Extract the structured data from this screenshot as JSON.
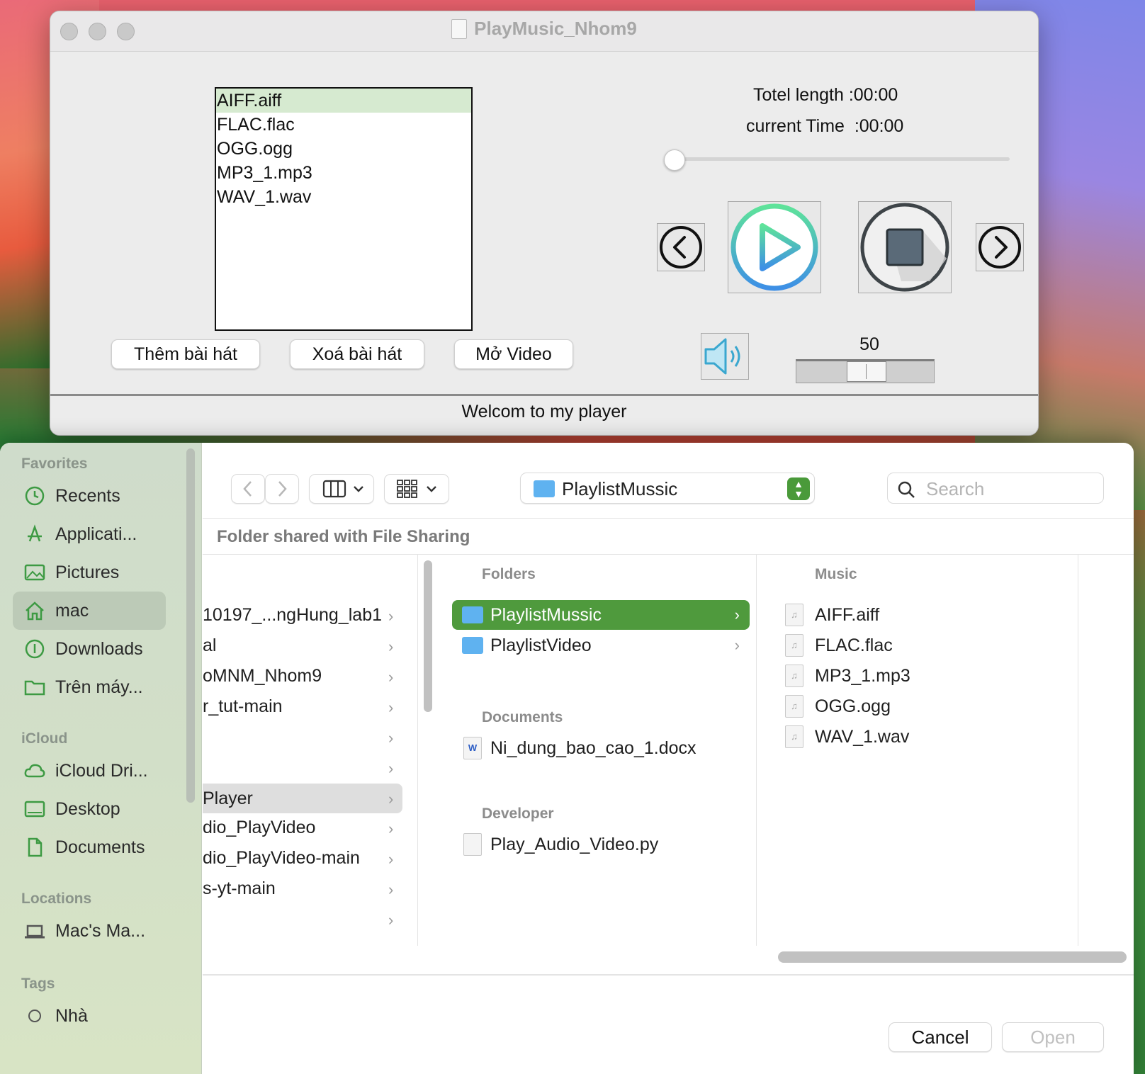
{
  "player": {
    "title": "PlayMusic_Nhom9",
    "playlist": [
      "AIFF.aiff",
      "FLAC.flac",
      "OGG.ogg",
      "MP3_1.mp3",
      "WAV_1.wav"
    ],
    "buttons": {
      "add": "Thêm bài hát",
      "delete": "Xoá bài hát",
      "video": "Mở Video"
    },
    "total_length": "Totel length :00:00",
    "current_time": "current Time  :00:00",
    "progress": 0,
    "volume": "50",
    "status": "Welcom to my player"
  },
  "dialog": {
    "path": "PlaylistMussic",
    "search_placeholder": "Search",
    "shared_banner": "Folder shared with File Sharing",
    "sidebar": {
      "favorites_head": "Favorites",
      "favorites": [
        "Recents",
        "Applicati...",
        "Pictures",
        "mac",
        "Downloads",
        "Trên máy..."
      ],
      "icloud_head": "iCloud",
      "icloud": [
        "iCloud Dri...",
        "Desktop",
        "Documents"
      ],
      "locations_head": "Locations",
      "locations": [
        "Mac's Ma..."
      ],
      "tags_head": "Tags",
      "tags": [
        "Nhà"
      ]
    },
    "col1": [
      "10197_...ngHung_lab1",
      "al",
      "oMNM_Nhom9",
      "r_tut-main",
      "",
      "",
      "Player",
      "dio_PlayVideo",
      "dio_PlayVideo-main",
      "s-yt-main",
      ""
    ],
    "col2": {
      "folders_head": "Folders",
      "folders": [
        "PlaylistMussic",
        "PlaylistVideo"
      ],
      "documents_head": "Documents",
      "documents": [
        "Ni_dung_bao_cao_1.docx"
      ],
      "developer_head": "Developer",
      "developer": [
        "Play_Audio_Video.py"
      ]
    },
    "col3": {
      "music_head": "Music",
      "music": [
        "AIFF.aiff",
        "FLAC.flac",
        "MP3_1.mp3",
        "OGG.ogg",
        "WAV_1.wav"
      ]
    },
    "cancel": "Cancel",
    "open": "Open"
  }
}
